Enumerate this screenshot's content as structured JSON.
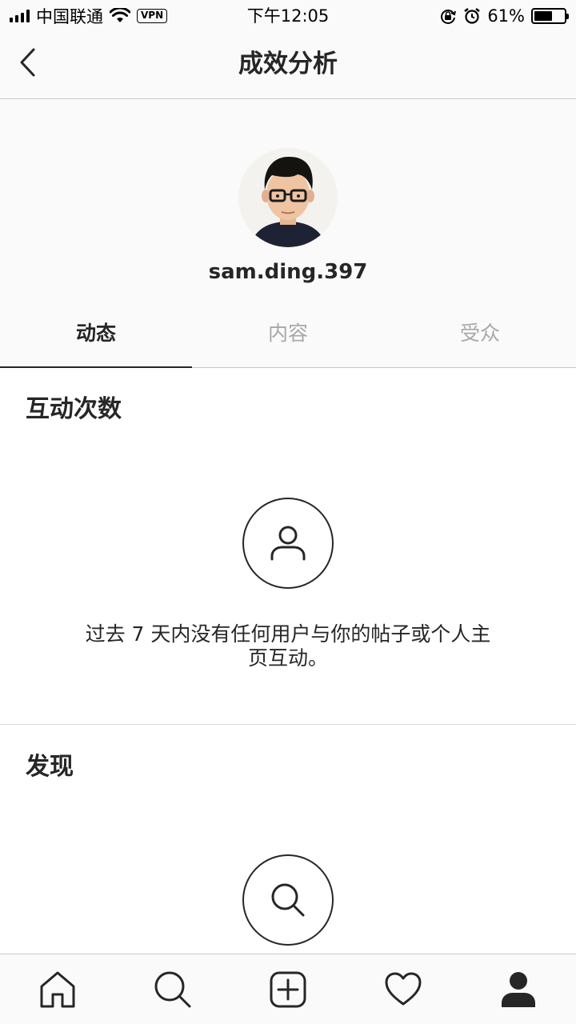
{
  "status_bar": {
    "carrier": "中国联通",
    "vpn": "VPN",
    "time": "下午12:05",
    "battery_percent": "61%",
    "battery_level": 0.61,
    "icons": [
      "signal-icon",
      "wifi-icon",
      "rotation-lock-icon",
      "alarm-icon",
      "battery-icon"
    ]
  },
  "nav": {
    "title": "成效分析",
    "back_icon": "chevron-left-icon"
  },
  "profile": {
    "username": "sam.ding.397"
  },
  "tabs": [
    {
      "label": "动态",
      "active": true
    },
    {
      "label": "内容",
      "active": false
    },
    {
      "label": "受众",
      "active": false
    }
  ],
  "interactions": {
    "title": "互动次数",
    "icon": "person-icon",
    "empty_message": "过去 7 天内没有任何用户与你的帖子或个人主页互动。"
  },
  "discovery": {
    "title": "发现",
    "icon": "search-icon"
  },
  "tab_bar": {
    "items": [
      "home-icon",
      "search-icon",
      "new-post-icon",
      "activity-heart-icon",
      "profile-icon"
    ]
  }
}
